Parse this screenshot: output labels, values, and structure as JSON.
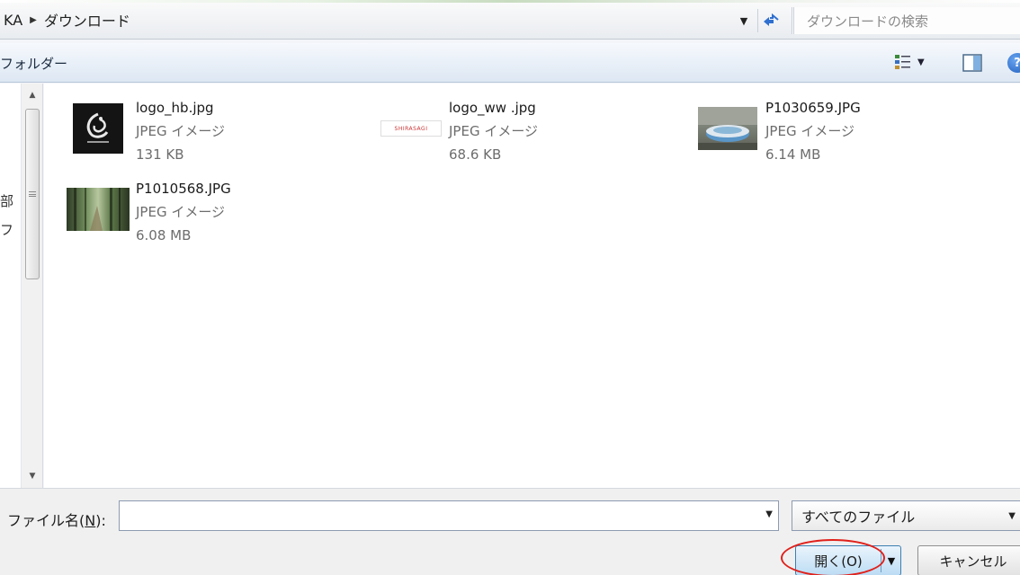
{
  "address_bar": {
    "crumbs": [
      "KA",
      "ダウンロード"
    ],
    "separator_icon": "breadcrumb-arrow-icon",
    "search_placeholder": "ダウンロードの検索"
  },
  "toolbar": {
    "new_folder_label": "フォルダー"
  },
  "nav_pane": {
    "glyphs": [
      "部",
      "フ"
    ]
  },
  "files": [
    {
      "name": "logo_hb.jpg",
      "type": "JPEG イメージ",
      "size": "131 KB",
      "thumb": "logo-hb"
    },
    {
      "name": "logo_ww .jpg",
      "type": "JPEG イメージ",
      "size": "68.6 KB",
      "thumb": "logo-ww",
      "thumb_text": "SHIRASAGI"
    },
    {
      "name": "P1030659.JPG",
      "type": "JPEG イメージ",
      "size": "6.14 MB",
      "thumb": "photo-bowl"
    },
    {
      "name": "P1010568.JPG",
      "type": "JPEG イメージ",
      "size": "6.08 MB",
      "thumb": "photo-forest"
    }
  ],
  "bottom": {
    "filename_label_prefix": "ファイル名(",
    "filename_label_key": "N",
    "filename_label_suffix": "):",
    "filename_value": "",
    "filetype_selected": "すべてのファイル",
    "open_label": "開く(O)",
    "cancel_label": "キャンセル"
  },
  "colors": {
    "highlight_ring": "#e0201a",
    "open_button": "#bcdcf4",
    "toolbar": "#dde7f3"
  }
}
